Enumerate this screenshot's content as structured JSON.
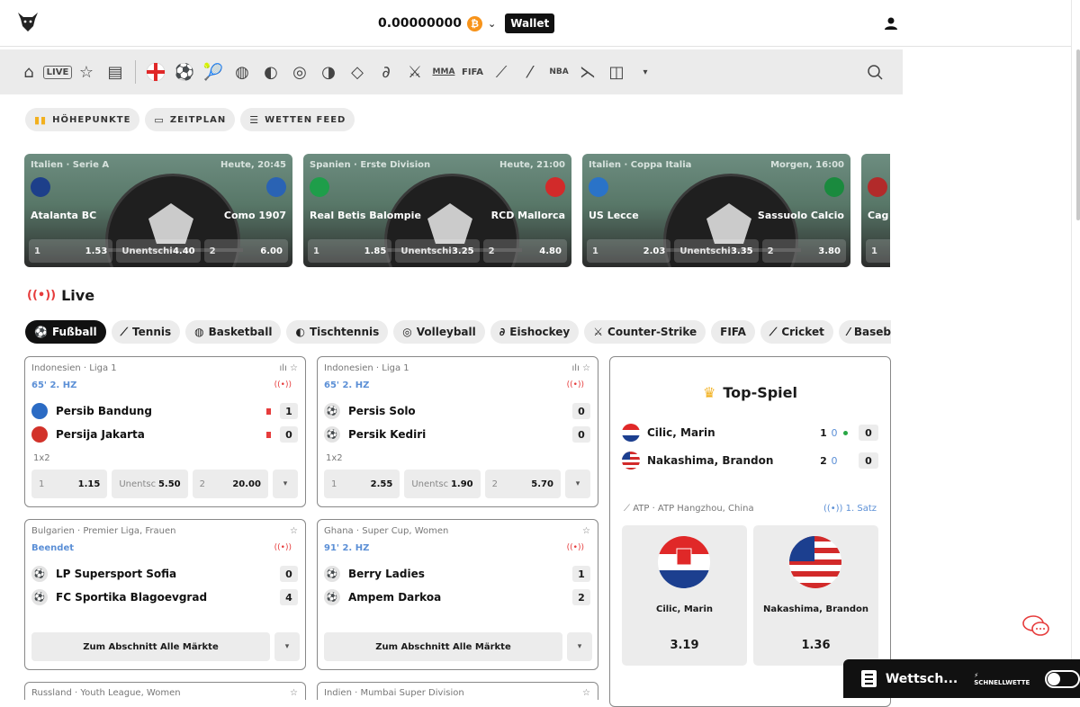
{
  "header": {
    "balance": "0.00000000",
    "currency_symbol": "₿",
    "wallet_label": "Wallet",
    "brand_color": "#111111",
    "btc_color": "#f7931a",
    "logo_icon": "bull-logo-icon",
    "user_icon": "user-icon"
  },
  "sport_nav": {
    "icons": [
      "home-icon",
      "live-icon",
      "star-icon",
      "betslip-icon",
      "england-flag-icon",
      "soccer-icon",
      "tennis-icon",
      "basketball-icon",
      "table-tennis-icon",
      "volleyball-icon",
      "ice-hockey-icon",
      "handball-icon",
      "baseball-icon",
      "counter-strike-icon",
      "mma-icon",
      "fifa-icon",
      "cricket-icon",
      "baseball-bat-icon",
      "nba2k-icon",
      "darts-icon",
      "american-football-icon",
      "more-icon",
      "search-icon"
    ],
    "live_label": "LIVE",
    "mma_label": "MMA",
    "fifa_label": "FIFA",
    "nba_label": "NBA"
  },
  "tabs": [
    {
      "label": "HÖHEPUNKTE"
    },
    {
      "label": "ZEITPLAN"
    },
    {
      "label": "WETTEN FEED"
    }
  ],
  "highlights": [
    {
      "league": "Italien · Serie A",
      "time": "Heute, 20:45",
      "home": "Atalanta BC",
      "away": "Como 1907",
      "odds": [
        {
          "label": "1",
          "value": "1.53"
        },
        {
          "label": "Unentschi",
          "value": "4.40"
        },
        {
          "label": "2",
          "value": "6.00"
        }
      ]
    },
    {
      "league": "Spanien · Erste Division",
      "time": "Heute, 21:00",
      "home": "Real Betis Balompie",
      "away": "RCD Mallorca",
      "odds": [
        {
          "label": "1",
          "value": "1.85"
        },
        {
          "label": "Unentschi",
          "value": "3.25"
        },
        {
          "label": "2",
          "value": "4.80"
        }
      ]
    },
    {
      "league": "Italien · Coppa Italia",
      "time": "Morgen, 16:00",
      "home": "US Lecce",
      "away": "Sassuolo Calcio",
      "odds": [
        {
          "label": "1",
          "value": "2.03"
        },
        {
          "label": "Unentschi",
          "value": "3.35"
        },
        {
          "label": "2",
          "value": "3.80"
        }
      ]
    },
    {
      "league": "",
      "time": "",
      "home": "Cag",
      "away": "",
      "odds": [
        {
          "label": "1",
          "value": ""
        }
      ]
    }
  ],
  "live": {
    "title": "Live",
    "sports": [
      "Fußball",
      "Tennis",
      "Basketball",
      "Tischtennis",
      "Volleyball",
      "Eishockey",
      "Counter-Strike",
      "FIFA",
      "Cricket",
      "Baseball"
    ]
  },
  "matches": [
    {
      "league": "Indonesien · Liga 1",
      "status": "65' 2. HZ",
      "home": "Persib Bandung",
      "away": "Persija Jakarta",
      "home_score": "1",
      "away_score": "0",
      "market": "1x2",
      "odds": [
        {
          "label": "1",
          "value": "1.15"
        },
        {
          "label": "Unentsc",
          "value": "5.50"
        },
        {
          "label": "2",
          "value": "20.00"
        }
      ]
    },
    {
      "league": "Indonesien · Liga 1",
      "status": "65' 2. HZ",
      "home": "Persis Solo",
      "away": "Persik Kediri",
      "home_score": "0",
      "away_score": "0",
      "market": "1x2",
      "odds": [
        {
          "label": "1",
          "value": "2.55"
        },
        {
          "label": "Unentsc",
          "value": "1.90"
        },
        {
          "label": "2",
          "value": "5.70"
        }
      ]
    },
    {
      "league": "Bulgarien · Premier Liga, Frauen",
      "status": "Beendet",
      "home": "LP Supersport Sofia",
      "away": "FC Sportika Blagoevgrad",
      "home_score": "0",
      "away_score": "4",
      "all_markets": "Zum Abschnitt Alle Märkte"
    },
    {
      "league": "Ghana · Super Cup, Women",
      "status": "91' 2. HZ",
      "home": "Berry Ladies",
      "away": "Ampem Darkoa",
      "home_score": "1",
      "away_score": "2",
      "all_markets": "Zum Abschnitt Alle Märkte"
    },
    {
      "league": "Russland · Youth League, Women"
    },
    {
      "league": "Indien · Mumbai Super Division"
    }
  ],
  "top_game": {
    "title": "Top-Spiel",
    "player1": "Cilic, Marin",
    "player2": "Nakashima, Brandon",
    "p1_games": "1",
    "p1_points": "0",
    "p1_sets": "0",
    "p2_games": "2",
    "p2_points": "0",
    "p2_sets": "0",
    "league": "ATP · ATP Hangzhou, China",
    "set": "1. Satz",
    "odd1": "3.19",
    "odd2": "1.36"
  },
  "betslip": {
    "label": "Wettsch...",
    "fast_bet": "SCHNELLWETTE"
  }
}
